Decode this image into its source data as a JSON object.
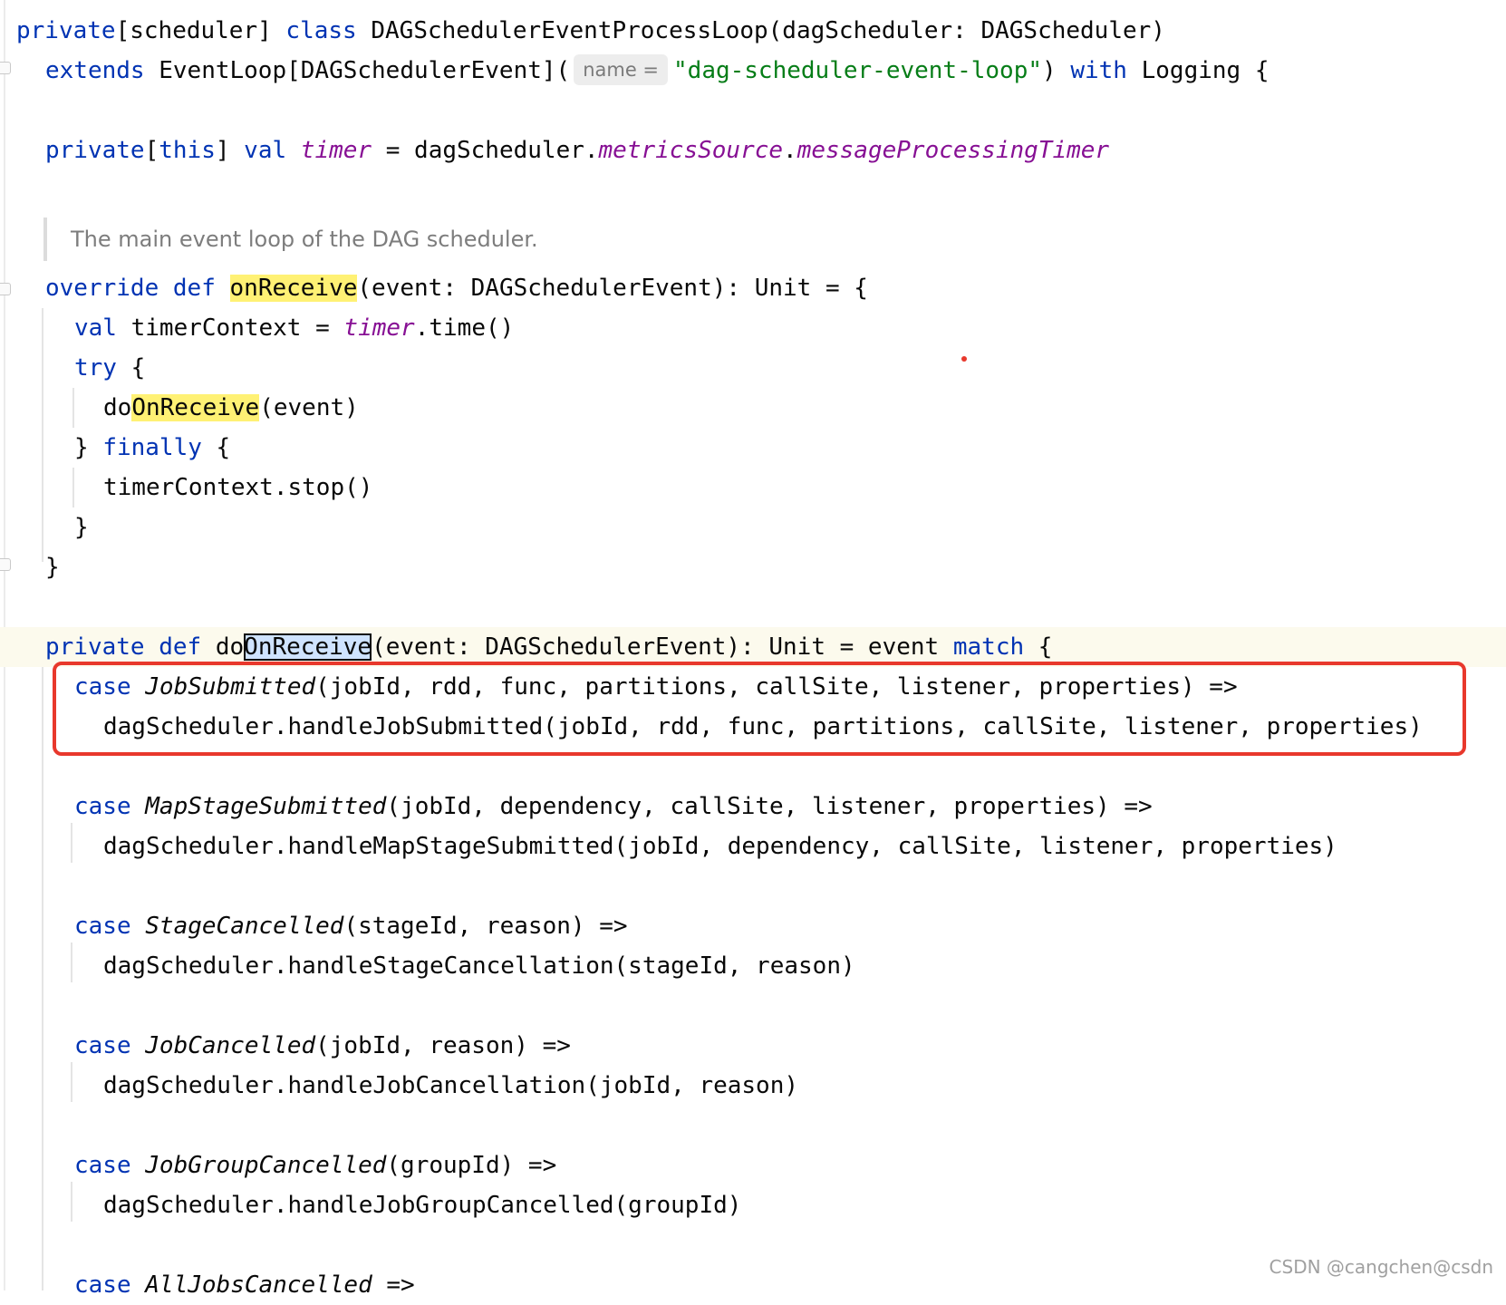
{
  "code": {
    "l01": {
      "kw_private": "private",
      "scope": "[scheduler] ",
      "kw_class": "class",
      "rest": " DAGSchedulerEventProcessLoop(dagScheduler: DAGScheduler)"
    },
    "l02": {
      "kw_extends": "extends",
      "mid": " EventLoop[DAGSchedulerEvent](",
      "hint": "name =",
      "str": "\"dag-scheduler-event-loop\"",
      "close": ")",
      "kw_with": "with",
      "rest": " Logging {"
    },
    "l03": {
      "kw_private": "private",
      "open": "[",
      "kw_this": "this",
      "close": "] ",
      "kw_val": "val",
      "timer": "timer",
      "eq": " = dagScheduler.",
      "metrics": "metricsSource",
      "dot": ".",
      "mpt": "messageProcessingTimer"
    },
    "doc": "The main event loop of the DAG scheduler.",
    "l04": {
      "kw_override": "override",
      "kw_def": "def",
      "fname": "onReceive",
      "rest": "(event: DAGSchedulerEvent): Unit = {"
    },
    "l05": {
      "kw_val": "val",
      "mid": " timerContext = ",
      "timer": "timer",
      "rest": ".time()"
    },
    "l06": {
      "kw_try": "try",
      "rest": " {"
    },
    "l07": {
      "prefix": "do",
      "fname": "OnReceive",
      "rest": "(event)"
    },
    "l08": {
      "brace": "} ",
      "kw_finally": "finally",
      "rest": " {"
    },
    "l09": {
      "text": "timerContext.stop()"
    },
    "l10": {
      "text": "}"
    },
    "l11": {
      "text": "}"
    },
    "l12": {
      "kw_private": "private",
      "kw_def": "def",
      "prefix": "do",
      "fname": "OnReceive",
      "rest": "(event: DAGSchedulerEvent): Unit = event ",
      "kw_match": "match",
      "brace": " {"
    },
    "cases": [
      {
        "kw": "case",
        "name": "JobSubmitted",
        "args": "(jobId, rdd, func, partitions, callSite, listener, properties) =>",
        "body": "dagScheduler.handleJobSubmitted(jobId, rdd, func, partitions, callSite, listener, properties)"
      },
      {
        "kw": "case",
        "name": "MapStageSubmitted",
        "args": "(jobId, dependency, callSite, listener, properties) =>",
        "body": "dagScheduler.handleMapStageSubmitted(jobId, dependency, callSite, listener, properties)"
      },
      {
        "kw": "case",
        "name": "StageCancelled",
        "args": "(stageId, reason) =>",
        "body": "dagScheduler.handleStageCancellation(stageId, reason)"
      },
      {
        "kw": "case",
        "name": "JobCancelled",
        "args": "(jobId, reason) =>",
        "body": "dagScheduler.handleJobCancellation(jobId, reason)"
      },
      {
        "kw": "case",
        "name": "JobGroupCancelled",
        "args": "(groupId) =>",
        "body": "dagScheduler.handleJobGroupCancelled(groupId)"
      },
      {
        "kw": "case",
        "name": "AllJobsCancelled",
        "args": " =>",
        "body": ""
      }
    ]
  },
  "colors": {
    "keyword": "#0033b3",
    "field": "#871094",
    "string": "#067d17",
    "search_highlight": "#fff174",
    "annotation_box": "#e8382c"
  },
  "watermark": "CSDN @cangchen@csdn"
}
